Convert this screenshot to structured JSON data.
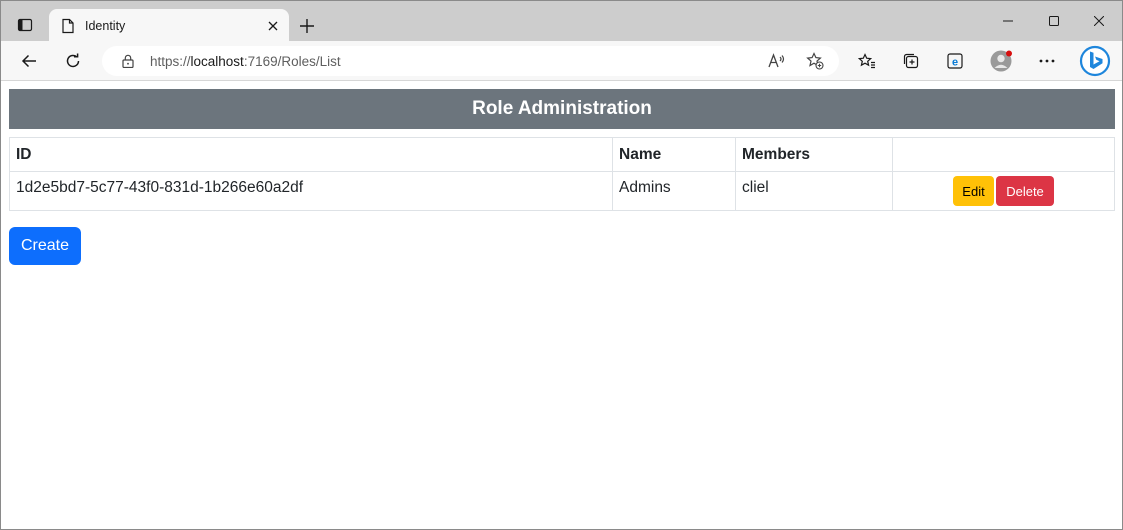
{
  "browser": {
    "tab_title": "Identity",
    "url_prefix": "https://",
    "url_host": "localhost",
    "url_rest": ":7169/Roles/List"
  },
  "page": {
    "heading": "Role Administration",
    "table": {
      "headers": [
        "ID",
        "Name",
        "Members",
        ""
      ],
      "rows": [
        {
          "id": "1d2e5bd7-5c77-43f0-831d-1b266e60a2df",
          "name": "Admins",
          "members": "cliel",
          "edit_label": "Edit",
          "delete_label": "Delete"
        }
      ]
    },
    "create_label": "Create"
  },
  "colors": {
    "banner": "#6c757d",
    "edit": "#ffc107",
    "delete": "#dc3545",
    "create": "#0d6efd"
  }
}
